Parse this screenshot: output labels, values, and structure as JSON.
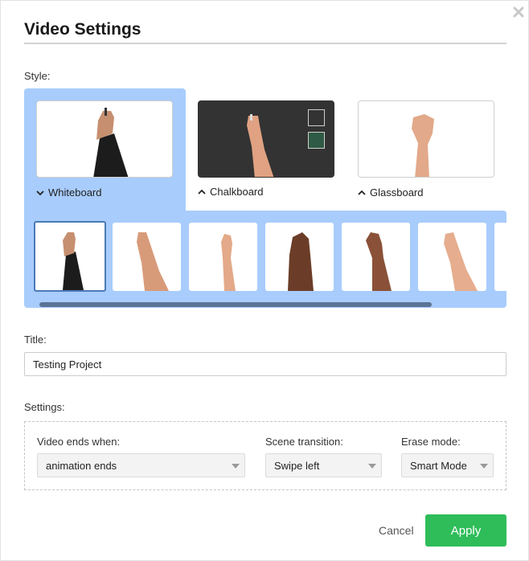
{
  "dialog": {
    "title": "Video Settings",
    "close_icon": "close-icon"
  },
  "style_section": {
    "label": "Style:",
    "options": [
      {
        "label": "Whiteboard",
        "chevron": "chevron-down-icon",
        "selected": true
      },
      {
        "label": "Chalkboard",
        "chevron": "chevron-up-icon",
        "selected": false
      },
      {
        "label": "Glassboard",
        "chevron": "chevron-up-icon",
        "selected": false
      }
    ],
    "hand_thumbnails": [
      {
        "name": "hand-dark-sleeve",
        "selected": true
      },
      {
        "name": "hand-light-1",
        "selected": false
      },
      {
        "name": "hand-light-2",
        "selected": false
      },
      {
        "name": "hand-dark-skin",
        "selected": false
      },
      {
        "name": "hand-medium-skin",
        "selected": false
      },
      {
        "name": "hand-light-3",
        "selected": false
      }
    ],
    "accent_color": "#a8ccfc"
  },
  "title_field": {
    "label": "Title:",
    "value": "Testing Project"
  },
  "settings": {
    "label": "Settings:",
    "video_ends_when": {
      "label": "Video ends when:",
      "value": "animation ends"
    },
    "scene_transition": {
      "label": "Scene transition:",
      "value": "Swipe left"
    },
    "erase_mode": {
      "label": "Erase mode:",
      "value": "Smart Mode"
    }
  },
  "footer": {
    "cancel_label": "Cancel",
    "apply_label": "Apply",
    "apply_color": "#2ebd59"
  }
}
